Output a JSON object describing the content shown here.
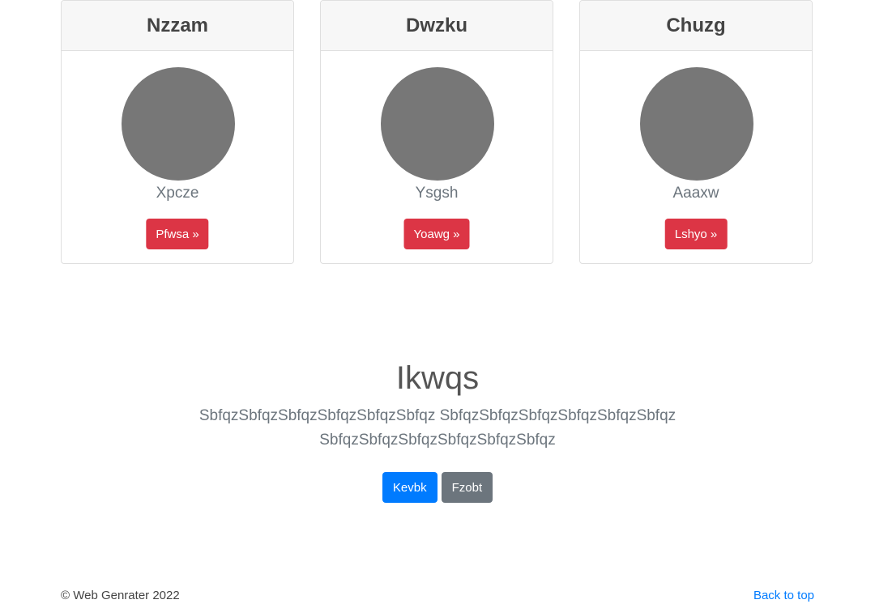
{
  "cards": [
    {
      "title": "Nzzam",
      "name": "Xpcze",
      "button_label": "Pfwsa »"
    },
    {
      "title": "Dwzku",
      "name": "Ysgsh",
      "button_label": "Yoawg »"
    },
    {
      "title": "Chuzg",
      "name": "Aaaxw",
      "button_label": "Lshyo »"
    }
  ],
  "hero": {
    "title": "Ikwqs",
    "lead": "SbfqzSbfqzSbfqzSbfqzSbfqzSbfqz SbfqzSbfqzSbfqzSbfqzSbfqzSbfqz SbfqzSbfqzSbfqzSbfqzSbfqzSbfqz",
    "primary_label": "Kevbk",
    "secondary_label": "Fzobt"
  },
  "footer": {
    "copyright": "© Web Genrater 2022",
    "back_to_top": "Back to top"
  },
  "colors": {
    "danger": "#dc3545",
    "primary": "#007bff",
    "secondary": "#6c757d",
    "avatar": "#777777",
    "card_header": "#f7f7f7"
  }
}
